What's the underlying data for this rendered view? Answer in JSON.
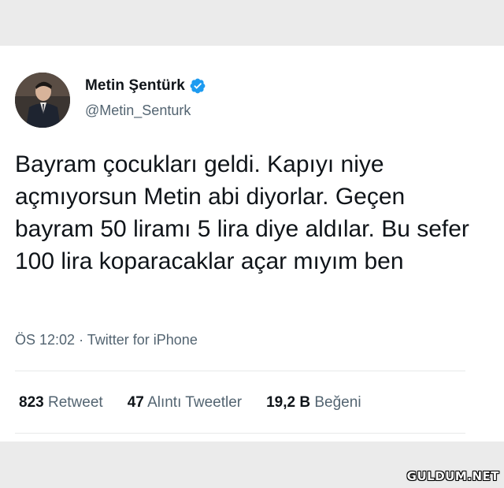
{
  "tweet": {
    "author_name": "Metin Şentürk",
    "handle": "@Metin_Senturk",
    "verified_icon": "verified-badge-icon",
    "text": "Bayram çocukları geldi. Kapıyı niye açmıyorsun Metin abi diyorlar. Geçen bayram 50 liramı 5 lira diye aldılar. Bu sefer 100 lira koparacaklar açar mıyım ben",
    "time": "ÖS 12:02",
    "separator": "·",
    "source": "Twitter for iPhone",
    "stats": [
      {
        "count": "823",
        "label": "Retweet"
      },
      {
        "count": "47",
        "label": "Alıntı Tweetler"
      },
      {
        "count": "19,2 B",
        "label": "Beğeni"
      }
    ]
  },
  "watermark": "GULDUM.NET",
  "colors": {
    "verified": "#1d9bf0",
    "text": "#0f1419",
    "secondary": "#536471",
    "background": "#ebebeb"
  }
}
